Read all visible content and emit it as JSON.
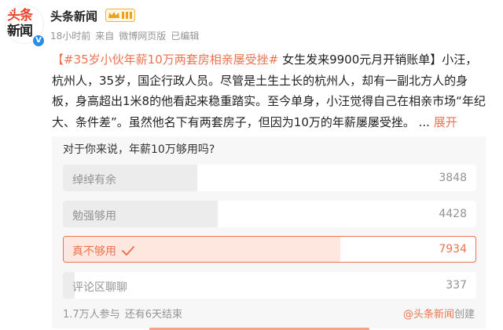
{
  "author": {
    "avatar_text_line1": "头条",
    "avatar_text_line2": "新闻",
    "verified_mark": "V",
    "name": "头条新闻",
    "vip_icon": "crown-vip-icon"
  },
  "meta": {
    "time": "18小时前",
    "source_prefix": "来自",
    "source": "微博网页版",
    "edited": "已编辑"
  },
  "post": {
    "topic": "【#35岁小伙年薪10万两套房相亲屡受挫#",
    "body": " 女生发来9900元月开销账单】小汪，杭州人，35岁，国企行政人员。尽管是土生土长的杭州人，却有一副北方人的身板，身高超出1米8的他看起来稳重踏实。至今单身，小汪觉得自己在相亲市场“年纪大、条件差”。虽然他名下有两套房子，但因为10万的年薪屡屡受挫。 ... ",
    "expand_label": "展开"
  },
  "poll": {
    "question": "对于你来说，年薪10万够用吗?",
    "total_votes": 16547,
    "options": [
      {
        "label": "绰绰有余",
        "count": "3848",
        "votes": 3848,
        "selected": false
      },
      {
        "label": "勉强够用",
        "count": "4428",
        "votes": 4428,
        "selected": false
      },
      {
        "label": "真不够用",
        "count": "7934",
        "votes": 7934,
        "selected": true
      },
      {
        "label": "评论区聊聊",
        "count": "337",
        "votes": 337,
        "selected": false
      }
    ],
    "participants": "1.7万人参与",
    "remaining": "还有6天结束",
    "creator_mention": "@头条新闻",
    "creator_suffix": "创建"
  },
  "colors": {
    "accent": "#eb7350",
    "verified": "#2b8ce8",
    "logo_red": "#e8442b"
  }
}
